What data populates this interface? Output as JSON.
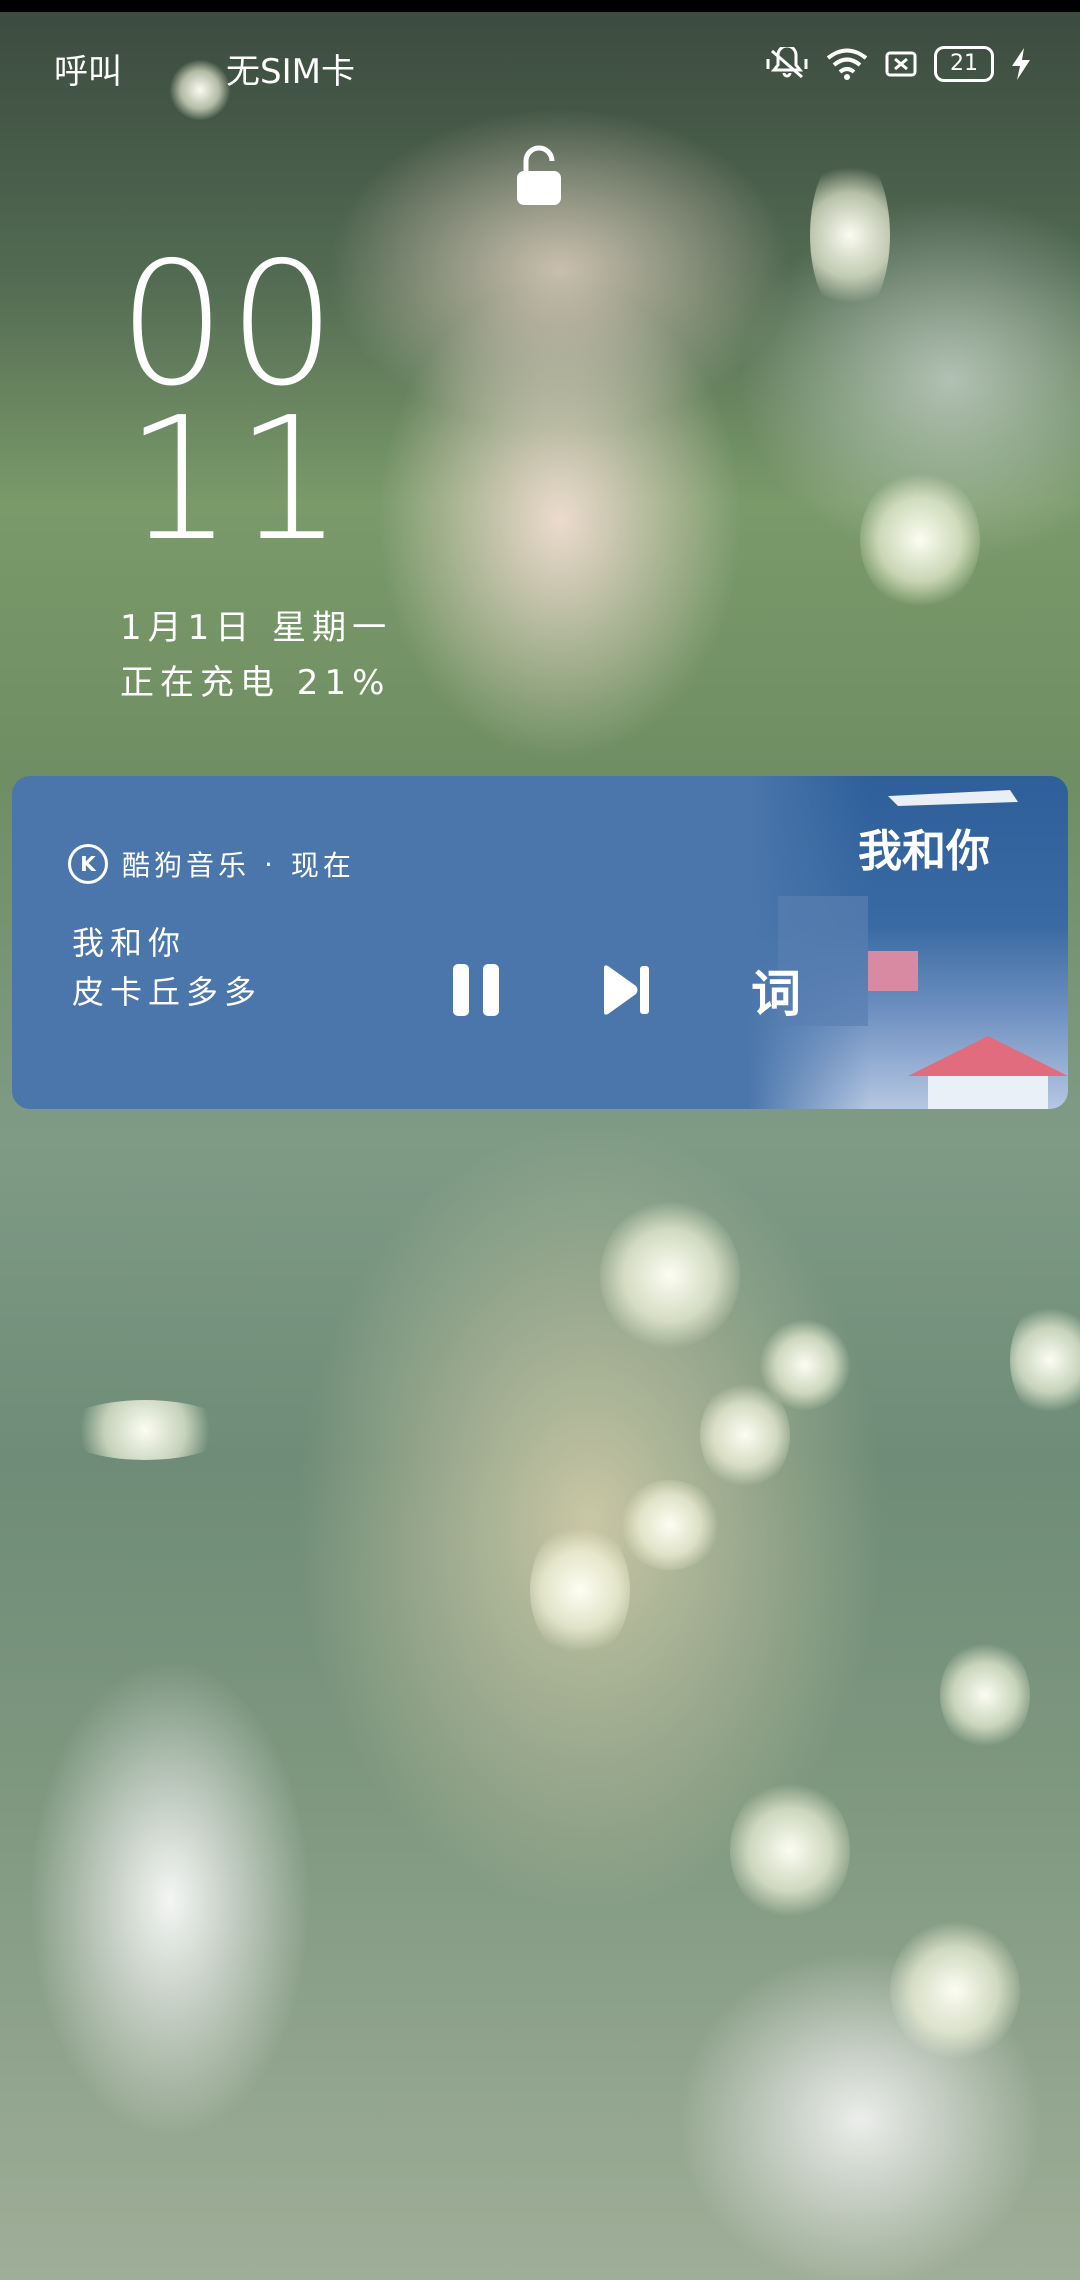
{
  "status_bar": {
    "carrier_1": "呼叫",
    "carrier_2": "无SIM卡",
    "battery_level": "21",
    "icons": [
      "mute-vibrate-icon",
      "wifi-icon",
      "no-sim-icon",
      "battery-icon",
      "charging-bolt-icon"
    ]
  },
  "lock": {
    "icon": "lock-open-icon"
  },
  "clock": {
    "hours": "00",
    "minutes": "11"
  },
  "date": {
    "text": "1月1日  星期一"
  },
  "charging": {
    "text": "正在充电 21%"
  },
  "music": {
    "app_name": "酷狗音乐",
    "separator": "·",
    "time": "现在",
    "song_title": "我和你",
    "artist": "皮卡丘多多",
    "lyrics_label": "词",
    "card_color": "#4a76ab"
  }
}
